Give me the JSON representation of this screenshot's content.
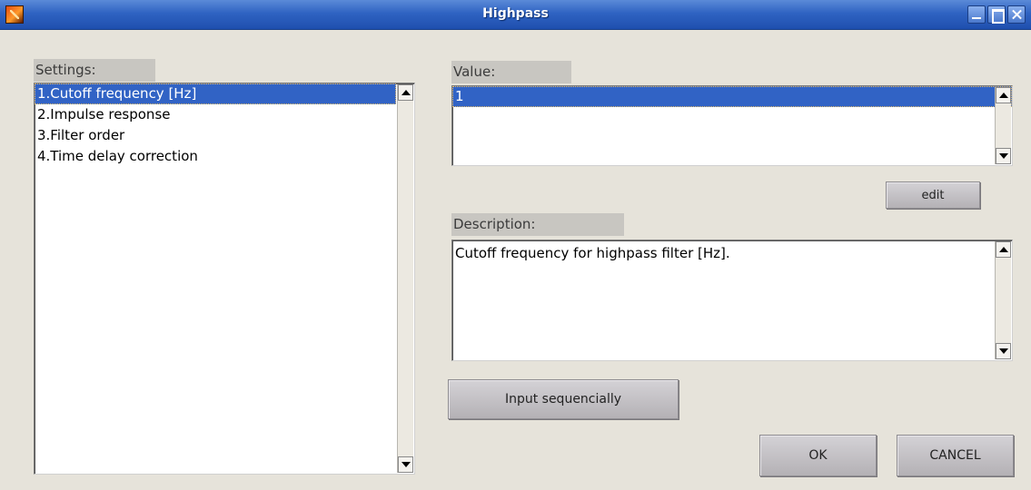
{
  "window": {
    "title": "Highpass",
    "icon": "matlab-logo-icon"
  },
  "settings": {
    "label": "Settings:",
    "items": [
      {
        "label": "1.Cutoff frequency [Hz]",
        "selected": true
      },
      {
        "label": "2.Impulse response",
        "selected": false
      },
      {
        "label": "3.Filter order",
        "selected": false
      },
      {
        "label": "4.Time delay correction",
        "selected": false
      }
    ]
  },
  "value": {
    "label": "Value:",
    "items": [
      "1"
    ],
    "edit_label": "edit"
  },
  "description": {
    "label": "Description:",
    "text": "Cutoff frequency for highpass filter [Hz]."
  },
  "buttons": {
    "input_sequencially": "Input sequencially",
    "ok": "OK",
    "cancel": "CANCEL"
  },
  "colors": {
    "titlebar": "#2f63c2",
    "selection": "#3163c5",
    "background": "#e6e3da"
  }
}
